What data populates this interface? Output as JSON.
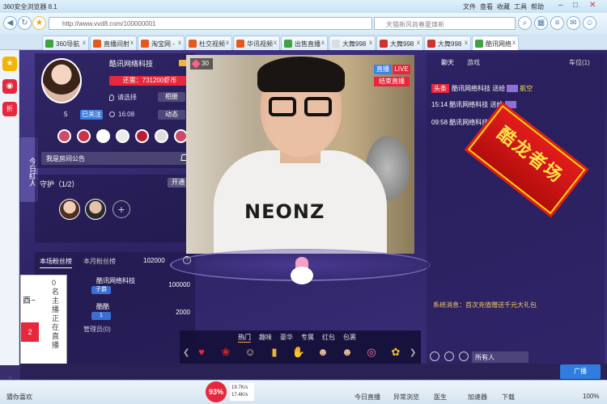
{
  "browser": {
    "title": "360安全浏览器 8.1",
    "menu": [
      "文件",
      "查看",
      "收藏",
      "工具",
      "帮助"
    ],
    "url": "http://www.vvd8.com/100000001",
    "search_placeholder": "天猫新风尚春夏焕新",
    "tabs": [
      "360导航",
      "直播间射",
      "淘宝网 -",
      "杜交视频",
      "华讯视频",
      "出售直播",
      "大舞998",
      "大舞998",
      "大舞998",
      "酷讯网络"
    ],
    "status_left": "猜你喜欢",
    "status_items": [
      "今日直播",
      "异常浏览",
      "医生",
      "加速器",
      "下载",
      "100%"
    ],
    "speed_up": "19.7K/s",
    "speed_down": "17.4K/s",
    "badge_pct": "93%"
  },
  "host": {
    "name": "酷讯网络科技",
    "balance": "还需：731200虾币",
    "location": "请选择",
    "fans": "5",
    "follow": "已关注",
    "time": "16:08",
    "btn_album": "相册",
    "btn_dynamic": "动态",
    "notice": "我是房间公告",
    "today_red": "今日红人"
  },
  "guard": {
    "title": "守护（1/2）",
    "open": "开通"
  },
  "rank": {
    "tab_this": "本场粉丝榜",
    "tab_month": "本月粉丝榜",
    "total": "102000",
    "rows": [
      {
        "name": "酷讯网络科技",
        "tag": "子爵",
        "value": "100000"
      },
      {
        "name": "酷酷",
        "tag": "1",
        "value": "2000"
      }
    ],
    "manager": "管理员(0)"
  },
  "popup": {
    "symbol": "酉~",
    "side_text": "0名主播正在直播",
    "red": "2"
  },
  "video": {
    "hearts": "30",
    "live_label": "直播",
    "live_badge": "LIVE",
    "end_live": "结束直播",
    "shirt": "NEONZ"
  },
  "gifts": {
    "tabs": [
      "热门",
      "趣味",
      "豪华",
      "专属",
      "红包",
      "包裹"
    ],
    "icons": [
      "heart-gift",
      "rose-gift",
      "face-gift",
      "beer-gift",
      "hand-gift",
      "kiss-gift",
      "couple-gift",
      "lollipop-gift",
      "wheat-gift"
    ]
  },
  "chat": {
    "tabs": [
      "聊天",
      "游戏",
      "",
      "车位(1)"
    ],
    "messages": [
      {
        "tag": "头条",
        "text": "酷讯网络科技 送给",
        "act": "航空"
      },
      {
        "time": "15:14",
        "text": "酷讯网络科技 送给",
        "act": ""
      },
      {
        "time": "09:58",
        "text": "酷讯网络科技 送给",
        "act": ""
      }
    ],
    "system": "系统消息：首次充值赠送千元大礼包",
    "audience": "所有人",
    "broadcast": "广播"
  },
  "ribbon": "酷龙者场"
}
